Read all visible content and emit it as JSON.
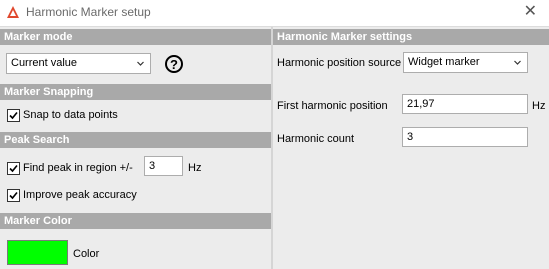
{
  "window": {
    "title": "Harmonic Marker setup",
    "close_glyph": "✕"
  },
  "left": {
    "marker_mode": {
      "header": "Marker mode",
      "selected": "Current value",
      "help_glyph": "?"
    },
    "marker_snapping": {
      "header": "Marker Snapping",
      "snap_label": "Snap to data points",
      "snap_checked": true
    },
    "peak_search": {
      "header": "Peak Search",
      "find_label": "Find peak in region +/-",
      "find_checked": true,
      "region_value": "3",
      "region_unit": "Hz",
      "improve_label": "Improve peak accuracy",
      "improve_checked": true
    },
    "marker_color": {
      "header": "Marker Color",
      "swatch_color": "#00ff00",
      "color_label": "Color"
    }
  },
  "right": {
    "header": "Harmonic Marker settings",
    "position_source_label": "Harmonic position source",
    "position_source_selected": "Widget marker",
    "first_harmonic_label": "First harmonic position",
    "first_harmonic_value": "21,97",
    "first_harmonic_unit": "Hz",
    "harmonic_count_label": "Harmonic count",
    "harmonic_count_value": "3"
  },
  "icons": {
    "app": "app-logo-icon",
    "close": "close-icon",
    "dropdown": "chevron-down-icon",
    "help": "help-icon",
    "check": "checkmark-icon"
  },
  "colors": {
    "header_bg": "#a9a9a9",
    "panel_bg": "#ececec",
    "app_icon": "#e0482e"
  }
}
